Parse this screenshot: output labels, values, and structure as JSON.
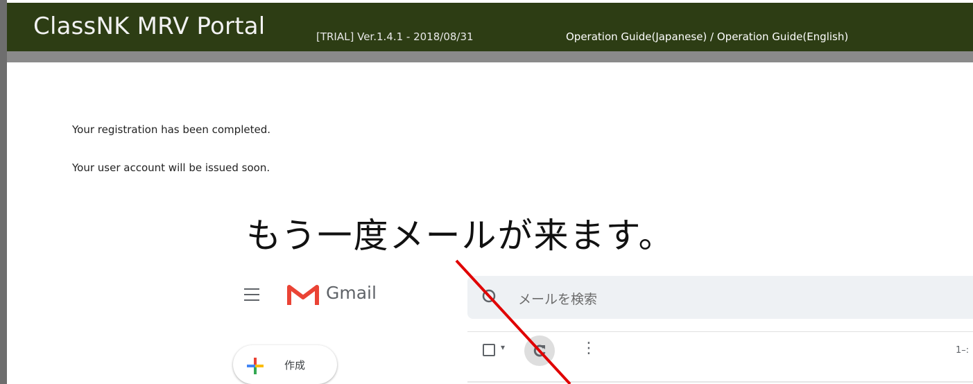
{
  "header": {
    "title": "ClassNK MRV Portal",
    "version": "[TRIAL] Ver.1.4.1 - 2018/08/31",
    "guide_japanese": "Operation Guide(Japanese)",
    "guide_separator": " / ",
    "guide_english": "Operation Guide(English)"
  },
  "messages": {
    "line1": "Your registration has been completed.",
    "line2": "Your user account will be issued soon."
  },
  "annotation": {
    "note": "もう一度メールが来ます。",
    "arrow_color": "#e00000"
  },
  "gmail": {
    "app_name": "Gmail",
    "search_placeholder": "メールを検索",
    "compose_label": "作成",
    "page_count": "1–:",
    "icons": [
      "menu-icon",
      "gmail-logo-icon",
      "search-icon",
      "compose-plus-icon",
      "checkbox-icon",
      "refresh-icon",
      "more-vert-icon"
    ]
  },
  "colors": {
    "header_bg": "#2d3d14",
    "frame_gray": "#6e6e6e",
    "gmail_red": "#ea4335"
  }
}
